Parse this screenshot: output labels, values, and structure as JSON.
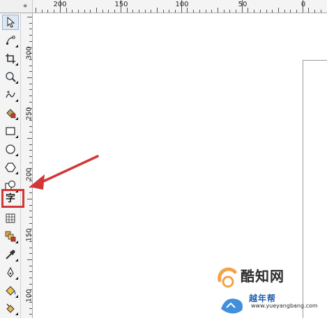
{
  "top_ruler": {
    "labels": [
      "200",
      "150",
      "100",
      "50",
      "0"
    ],
    "corner_icon": "crosshair-icon"
  },
  "side_ruler": {
    "labels": [
      "300",
      "250",
      "200",
      "150",
      "100"
    ]
  },
  "toolbox": {
    "tools": [
      {
        "id": "pick",
        "icon": "pointer-arrow-icon",
        "selected": true
      },
      {
        "id": "shape",
        "icon": "shape-node-icon"
      },
      {
        "id": "crop",
        "icon": "crop-icon"
      },
      {
        "id": "zoom",
        "icon": "zoom-icon"
      },
      {
        "id": "freehand",
        "icon": "freehand-curve-icon"
      },
      {
        "id": "smart-fill",
        "icon": "smart-fill-icon"
      },
      {
        "id": "rectangle",
        "icon": "rectangle-icon"
      },
      {
        "id": "ellipse",
        "icon": "ellipse-icon"
      },
      {
        "id": "polygon",
        "icon": "polygon-icon"
      },
      {
        "id": "basic-shapes",
        "icon": "basic-shapes-icon"
      },
      {
        "id": "text",
        "icon": "text-tool-icon",
        "glyph": "字"
      },
      {
        "id": "table",
        "icon": "table-icon"
      },
      {
        "id": "parallel-dimension",
        "icon": "blend-icon"
      },
      {
        "id": "eyedropper",
        "icon": "eyedropper-icon"
      },
      {
        "id": "outline",
        "icon": "pen-nib-icon"
      },
      {
        "id": "fill",
        "icon": "paint-bucket-icon"
      },
      {
        "id": "interactive-fill",
        "icon": "interactive-fill-icon"
      }
    ]
  },
  "annotation": {
    "color": "#d33636"
  },
  "watermark": {
    "title": "酷知网",
    "title2": "越年帮",
    "url": "www.yueyangbang.com"
  }
}
